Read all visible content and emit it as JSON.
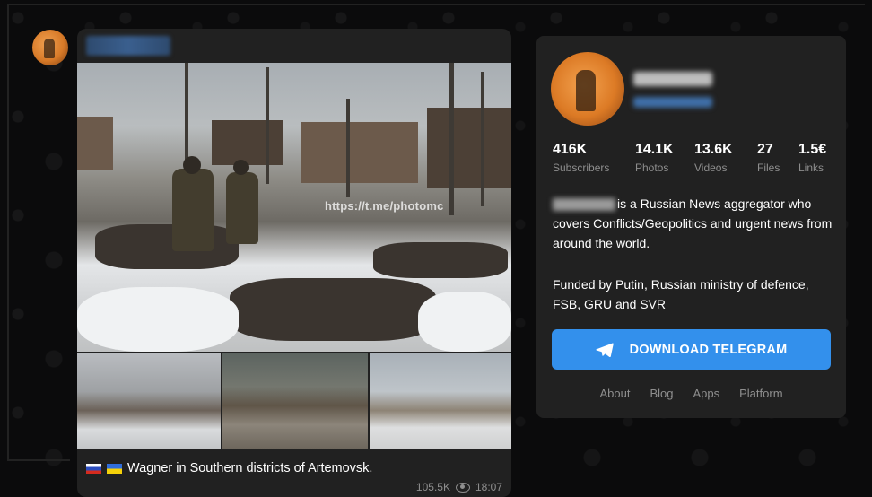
{
  "post": {
    "watermark": "https://t.me/photomc",
    "caption": "Wagner in Southern districts of Artemovsk.",
    "caption_flags": [
      "russia-flag",
      "ukraine-flag"
    ],
    "views": "105.5K",
    "time": "18:07"
  },
  "channel": {
    "stats": [
      {
        "value": "416K",
        "label": "Subscribers"
      },
      {
        "value": "14.1K",
        "label": "Photos"
      },
      {
        "value": "13.6K",
        "label": "Videos"
      },
      {
        "value": "27",
        "label": "Files"
      },
      {
        "value": "1.5€",
        "label": "Links"
      }
    ],
    "description": "is a Russian News aggregator who covers Conflicts/Geopolitics and urgent news from around the world.",
    "description2": "Funded by Putin, Russian ministry of defence, FSB, GRU and SVR",
    "download_label": "DOWNLOAD TELEGRAM",
    "footer_links": [
      "About",
      "Blog",
      "Apps",
      "Platform"
    ]
  },
  "colors": {
    "accent": "#3390ec",
    "panel": "#212121",
    "background": "#0b0b0c",
    "muted_text": "#8f8f8f"
  }
}
